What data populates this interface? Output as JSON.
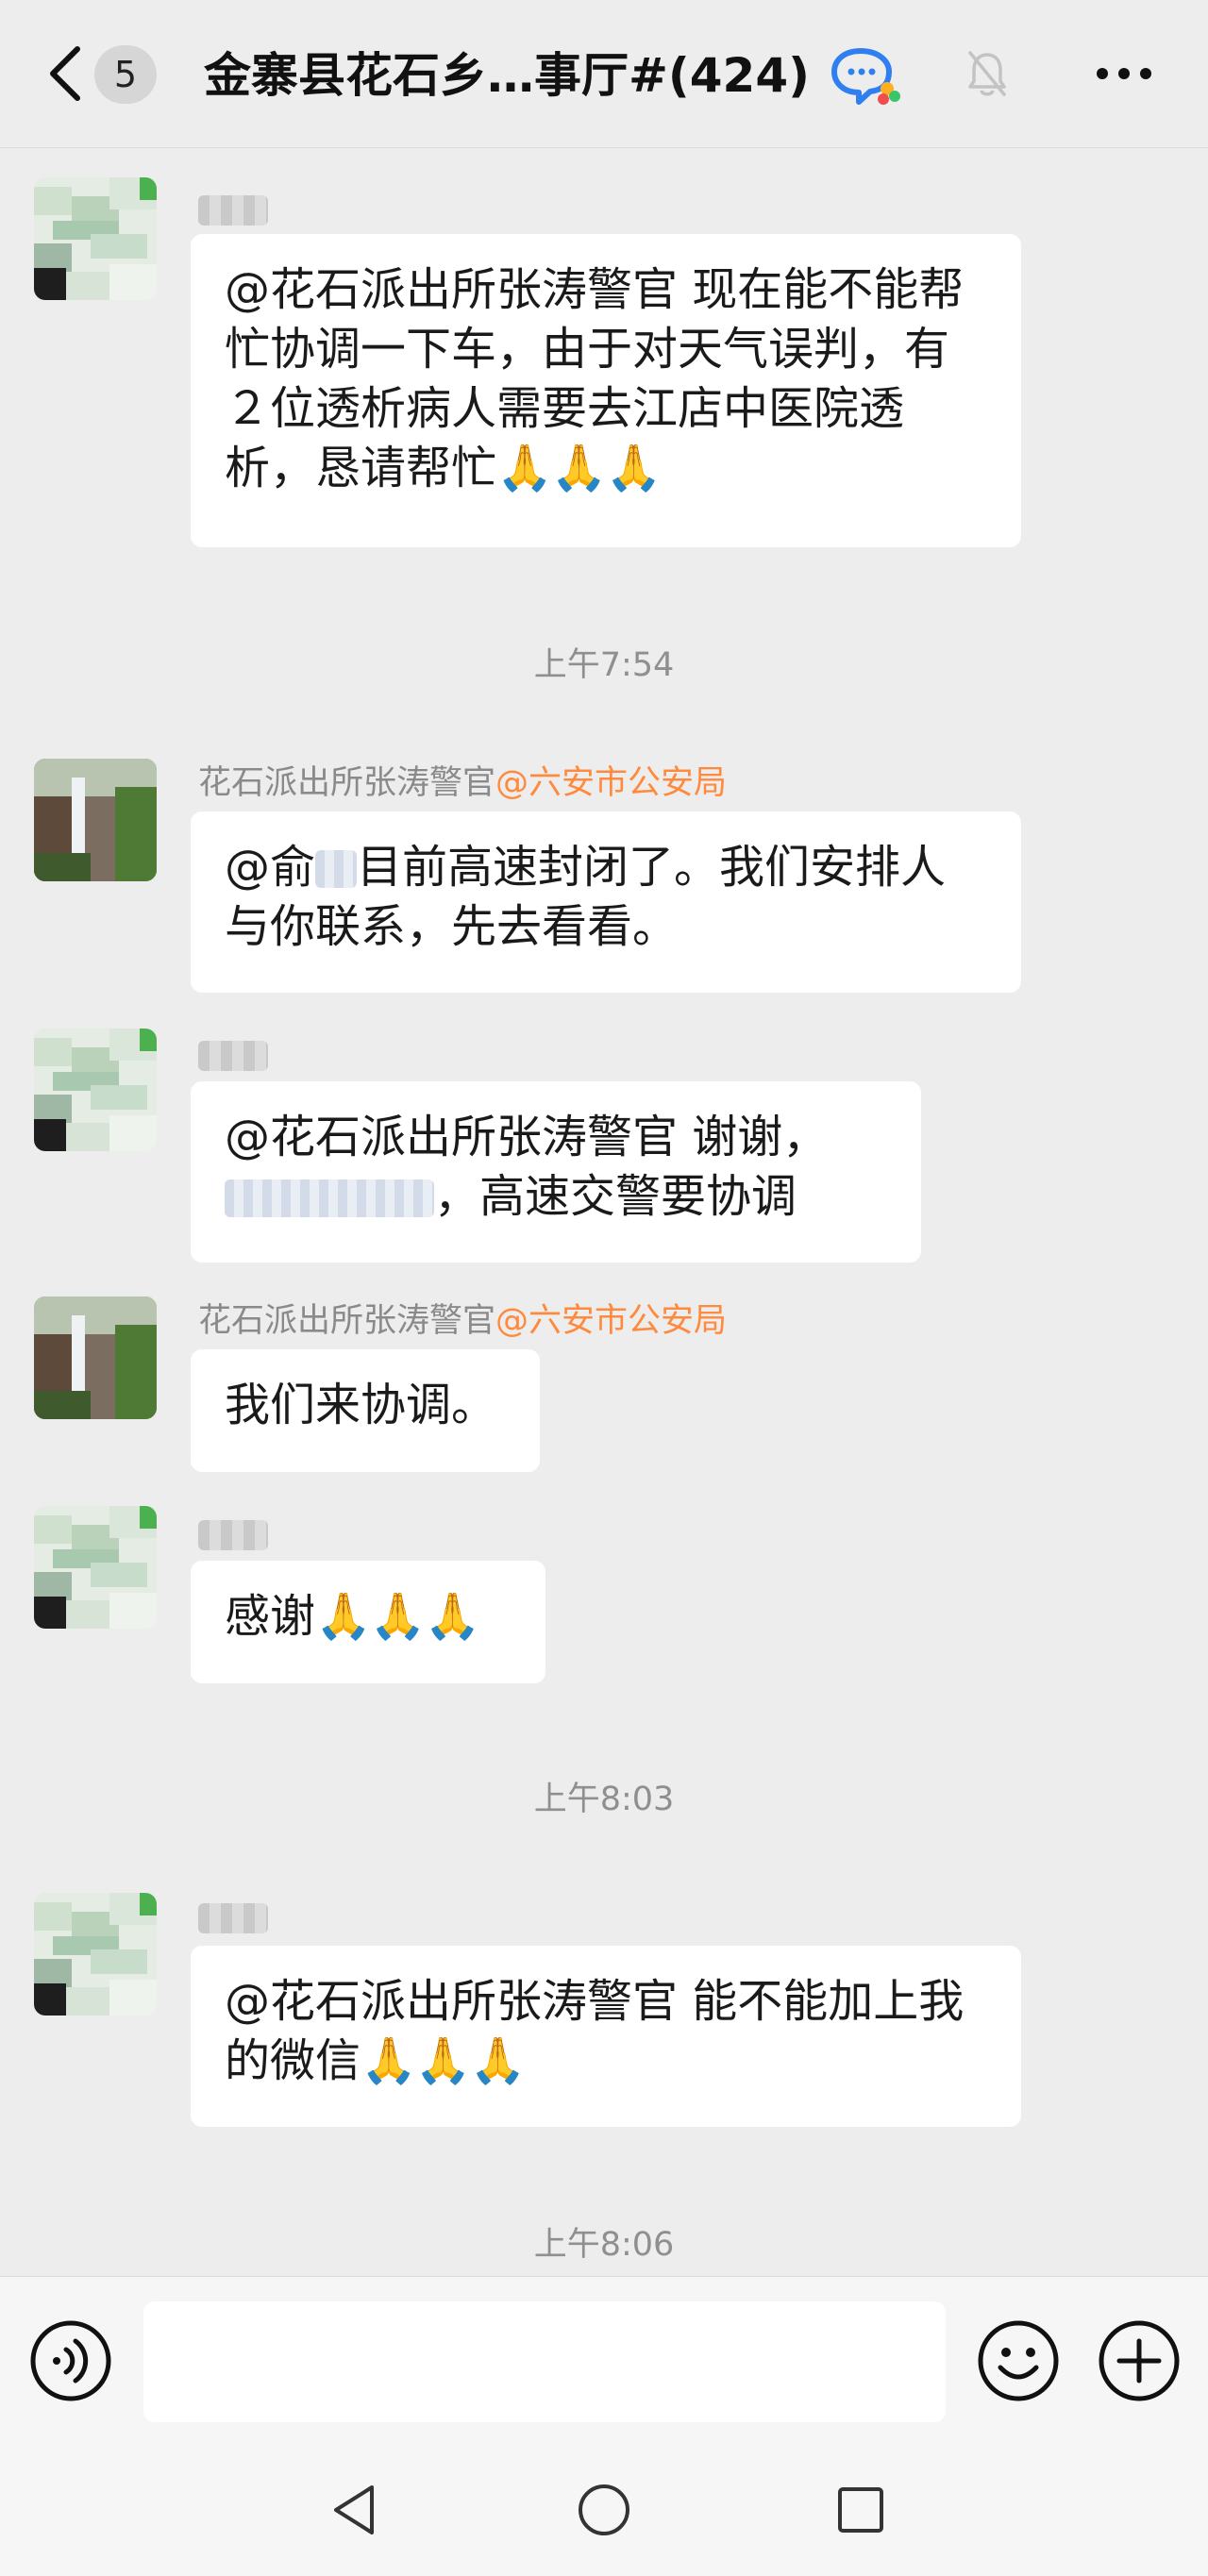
{
  "header": {
    "unread_count": "5",
    "title": "金寨县花石乡…事厅#(424)"
  },
  "messages": [
    {
      "type": "text",
      "sender": "",
      "text": "@花石派出所张涛警官 现在能不能帮忙协调一下车，由于对天气误判，有２位透析病人需要去江店中医院透析，恳请帮忙",
      "emoji": "🙏🙏🙏"
    },
    {
      "type": "time",
      "text": "上午7:54"
    },
    {
      "type": "text",
      "sender": "花石派出所张涛警官",
      "org": "@六安市公安局",
      "prefix": "@俞",
      "text": "目前高速封闭了。我们安排人与你联系，先去看看。"
    },
    {
      "type": "text",
      "sender": "",
      "text_a": "@花石派出所张涛警官 谢谢，",
      "text_b": "，高速交警要协调"
    },
    {
      "type": "text",
      "sender": "花石派出所张涛警官",
      "org": "@六安市公安局",
      "text": "我们来协调。"
    },
    {
      "type": "text",
      "sender": "",
      "text": "感谢",
      "emoji": "🙏🙏🙏"
    },
    {
      "type": "time",
      "text": "上午8:03"
    },
    {
      "type": "text",
      "sender": "",
      "text": "@花石派出所张涛警官 能不能加上我的微信",
      "emoji": "🙏🙏🙏"
    },
    {
      "type": "time",
      "text": "上午8:06"
    }
  ],
  "input": {
    "value": "",
    "placeholder": ""
  },
  "icons": {
    "back": "chevron-left-icon",
    "group_chat": "group-chat-icon",
    "mute": "muted-bell-icon",
    "more": "more-icon",
    "voice": "voice-icon",
    "emoji": "emoji-icon",
    "plus": "plus-icon",
    "nav_back": "nav-back-icon",
    "nav_home": "nav-home-icon",
    "nav_recent": "nav-recent-icon"
  },
  "colors": {
    "org_tag": "#ff8a3d",
    "background": "#ededed",
    "bubble": "#ffffff",
    "timestamp": "#8f8f8f"
  }
}
